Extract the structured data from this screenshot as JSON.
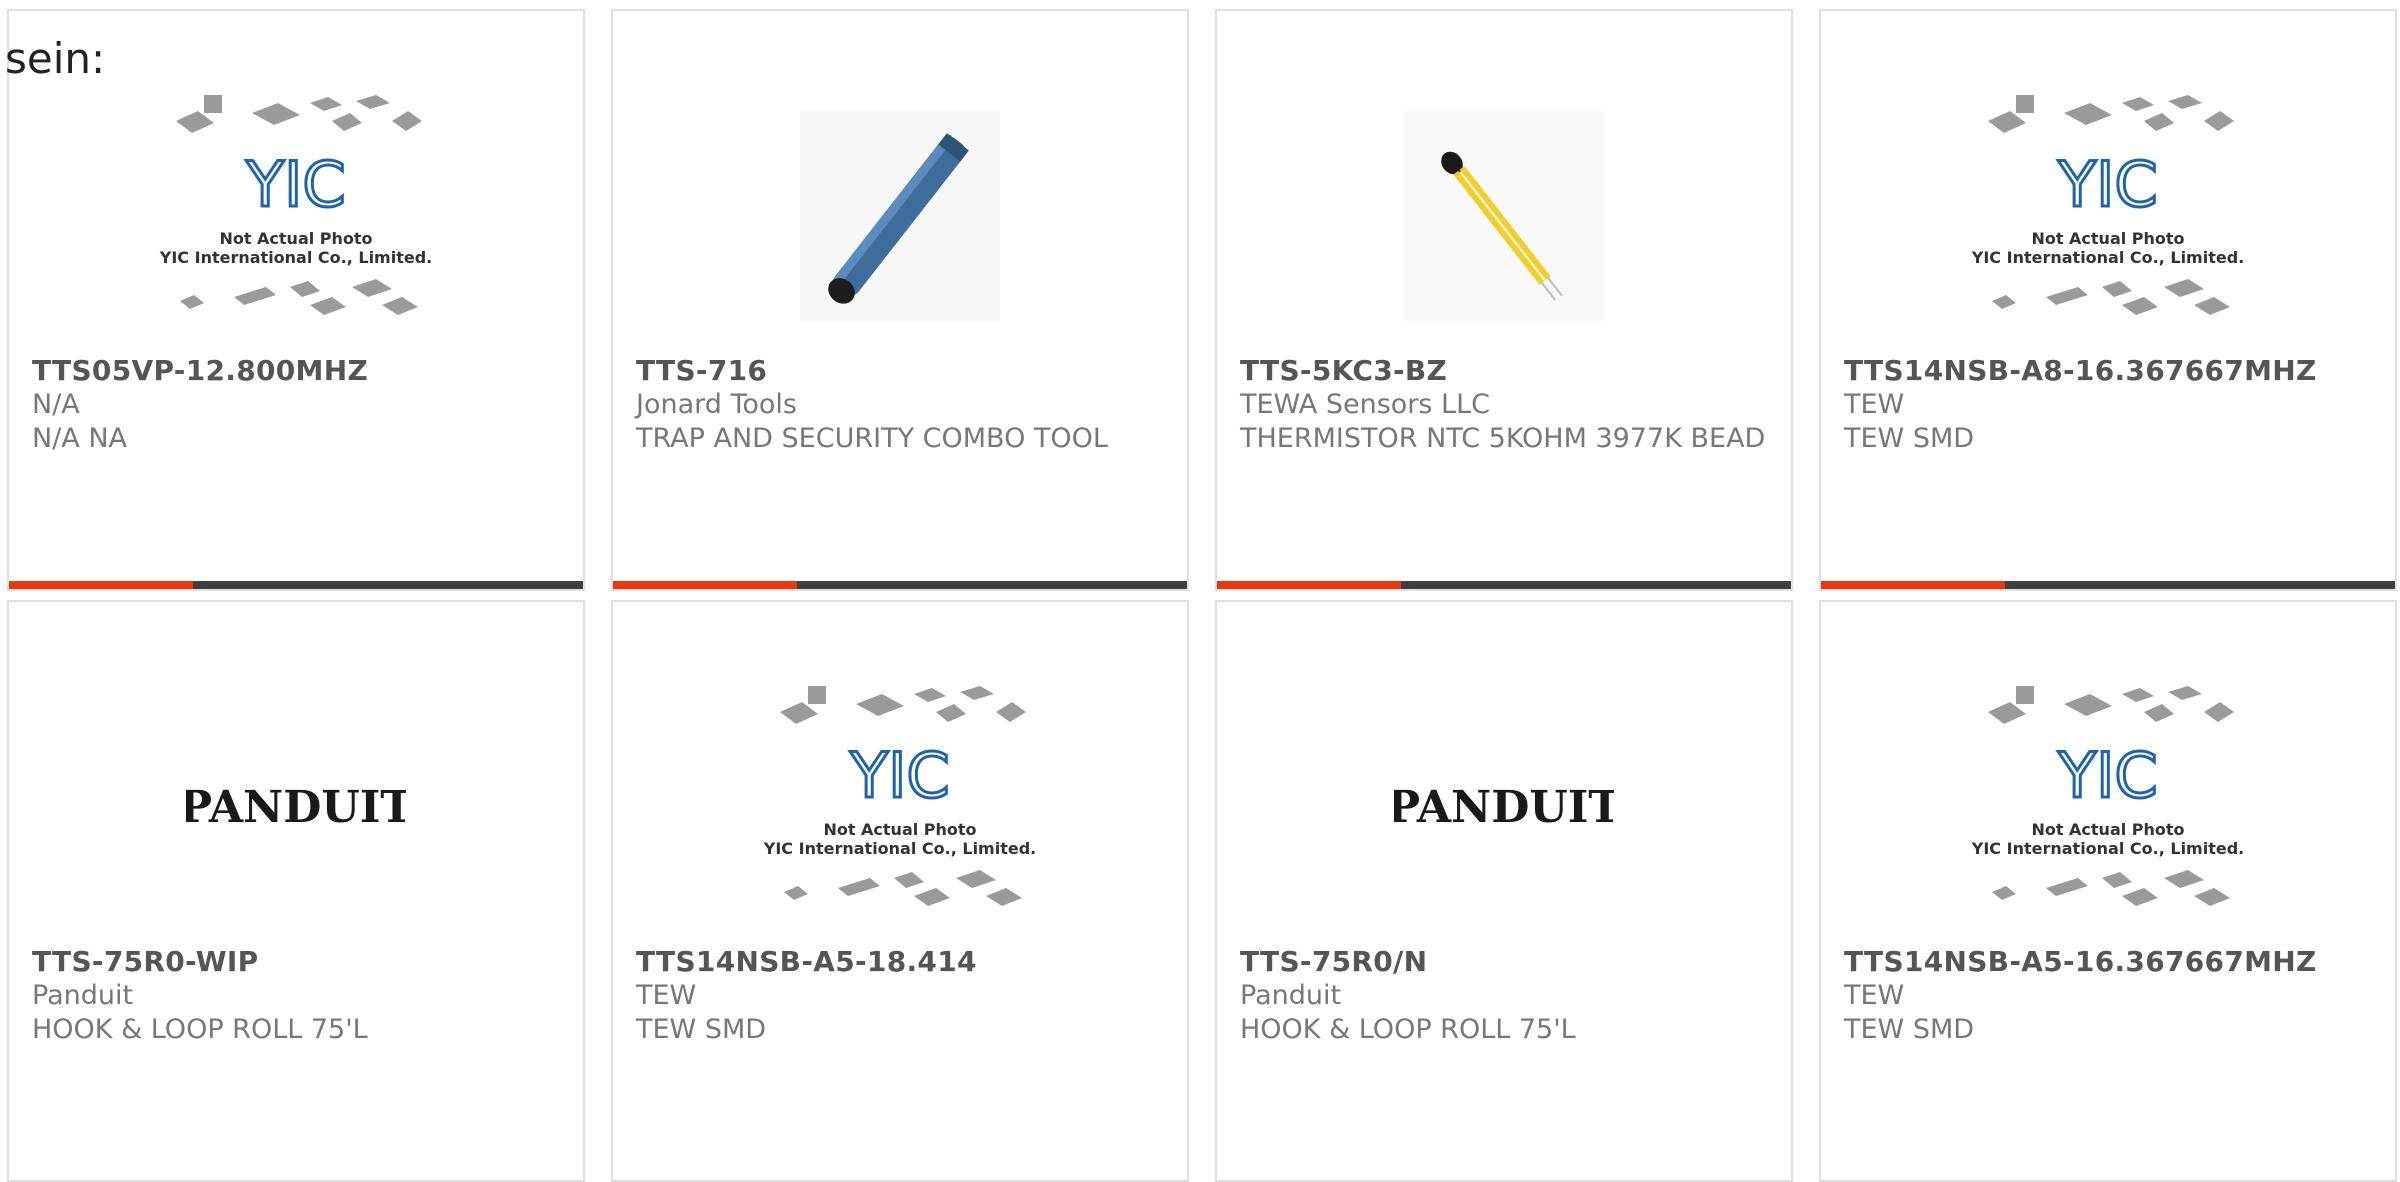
{
  "lead_text": "sein:",
  "placeholder_caption": {
    "line1": "Not Actual Photo",
    "line2": "YIC International Co., Limited.",
    "logo": "YIC"
  },
  "panduit_logo": "PANDUIT",
  "colors": {
    "accent": "#e53a0f",
    "bar": "#3f3f3f",
    "text": "#555555"
  },
  "products": [
    {
      "part": "TTS05VP-12.800MHZ",
      "manufacturer": "N/A",
      "description": "N/A NA",
      "image": "yic-placeholder",
      "progress": 0.32
    },
    {
      "part": "TTS-716",
      "manufacturer": "Jonard Tools",
      "description": "TRAP AND SECURITY COMBO TOOL",
      "image": "blue-tool-photo",
      "progress": 0.32
    },
    {
      "part": "TTS-5KC3-BZ",
      "manufacturer": "TEWA Sensors LLC",
      "description": "THERMISTOR NTC 5KOHM 3977K BEAD",
      "image": "thermistor-photo",
      "progress": 0.32
    },
    {
      "part": "TTS14NSB-A8-16.367667MHZ",
      "manufacturer": "TEW",
      "description": "TEW SMD",
      "image": "yic-placeholder",
      "progress": 0.32
    },
    {
      "part": "TTS-75R0-WIP",
      "manufacturer": "Panduit",
      "description": "HOOK & LOOP ROLL 75'L",
      "image": "panduit-logo"
    },
    {
      "part": "TTS14NSB-A5-18.414",
      "manufacturer": "TEW",
      "description": "TEW SMD",
      "image": "yic-placeholder"
    },
    {
      "part": "TTS-75R0/N",
      "manufacturer": "Panduit",
      "description": "HOOK & LOOP ROLL 75'L",
      "image": "panduit-logo"
    },
    {
      "part": "TTS14NSB-A5-16.367667MHZ",
      "manufacturer": "TEW",
      "description": "TEW SMD",
      "image": "yic-placeholder"
    }
  ]
}
